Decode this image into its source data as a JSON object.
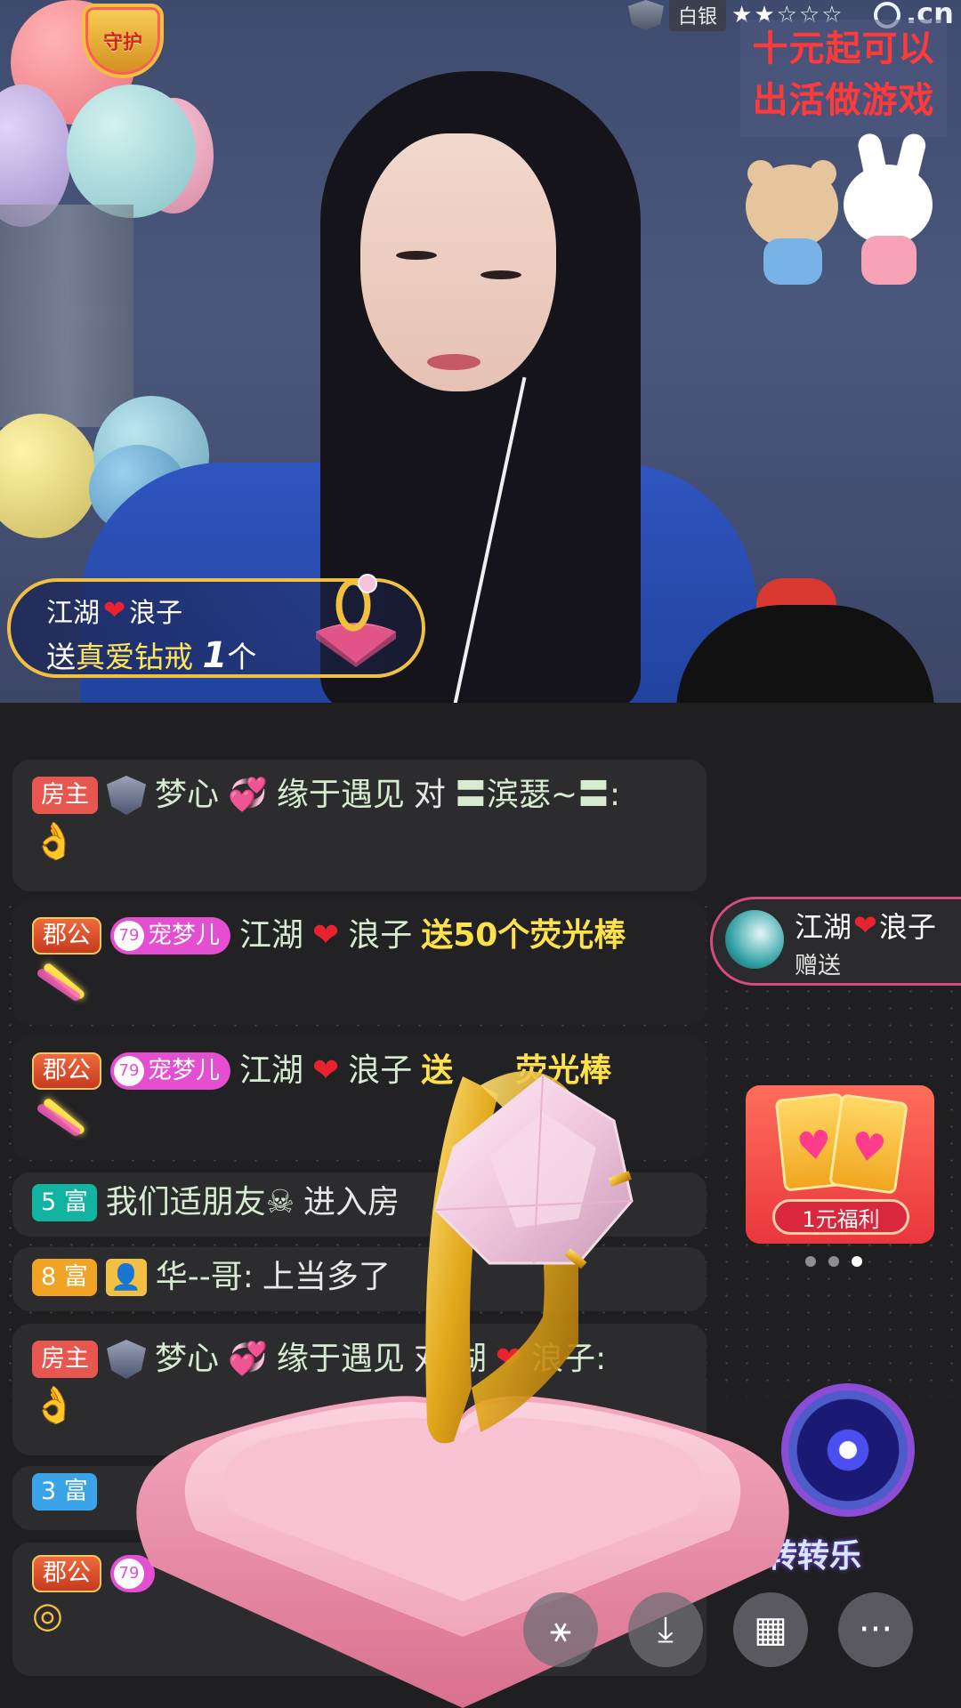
{
  "header": {
    "guard_badge": "守护",
    "rank": "白银",
    "stars": "★★☆☆☆",
    "site": ".cn",
    "promo_line1": "十元起可以",
    "promo_line2": "出活做游戏"
  },
  "gift_banner": {
    "user_a": "江湖",
    "user_b": "浪子",
    "send": "送",
    "gift": "真爱钻戒",
    "count": "1",
    "unit": "个"
  },
  "messages": [
    {
      "badge": "房主",
      "name": "梦心",
      "name2": "缘于遇见",
      "action": "对",
      "target": "〓滨瑟~〓:",
      "line2": "👌"
    },
    {
      "badge": "郡公",
      "pet_level": "79",
      "pet": "宠梦儿",
      "name": "江湖",
      "name2": "浪子",
      "gift": "送50个荧光棒"
    },
    {
      "badge": "郡公",
      "pet_level": "79",
      "pet": "宠梦儿",
      "name": "江湖",
      "name2": "浪子",
      "gift": "送",
      "gift2": "荧光棒"
    },
    {
      "badge": "5 富",
      "name": "我们适朋友☠",
      "action": "进入房"
    },
    {
      "badge": "8 富",
      "name": "华--哥:",
      "text": "上当多了"
    },
    {
      "badge": "房主",
      "name": "梦心",
      "name2": "缘于遇见",
      "action": "对",
      "target": "湖",
      "target2": "浪子:",
      "line2": "👌"
    },
    {
      "badge": "3 富"
    },
    {
      "badge": "郡公",
      "pet_level": "79"
    }
  ],
  "side_gift": {
    "user_a": "江湖",
    "user_b": "浪子",
    "action": "赠送"
  },
  "welfare": {
    "label": "1元福利"
  },
  "wheel": {
    "label": "转转乐"
  },
  "actions": {
    "share": "⚹",
    "download": "⤓",
    "grid": "▦",
    "more": "···"
  }
}
